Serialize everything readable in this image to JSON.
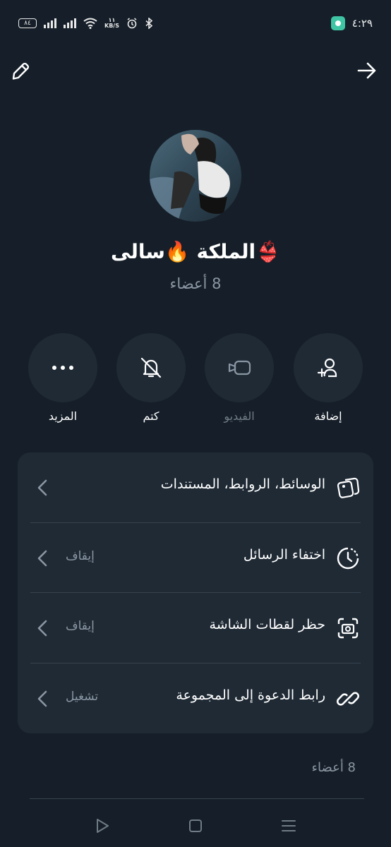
{
  "status_bar": {
    "battery": "٨٤",
    "net_speed_value": "١١",
    "net_speed_unit": "KB/S",
    "time": "٤:٢٩"
  },
  "group": {
    "title": "👙الملكة 🔥سالى",
    "members": "8 أعضاء"
  },
  "actions": [
    {
      "label": "إضافة",
      "icon": "add-person-icon"
    },
    {
      "label": "الفيديو",
      "icon": "video-camera-icon"
    },
    {
      "label": "كتم",
      "icon": "bell-muted-icon"
    },
    {
      "label": "المزيد",
      "icon": "more-dots-icon"
    }
  ],
  "settings": [
    {
      "title": "الوسائط، الروابط، المستندات",
      "status": "",
      "icon": "media-gallery-icon"
    },
    {
      "title": "اختفاء الرسائل",
      "status": "إيقاف",
      "icon": "disappearing-timer-icon"
    },
    {
      "title": "حظر لقطات الشاشة",
      "status": "إيقاف",
      "icon": "screenshot-block-icon"
    },
    {
      "title": "رابط الدعوة إلى المجموعة",
      "status": "تشغيل",
      "icon": "link-icon"
    }
  ],
  "members_heading": "8 أعضاء",
  "colors": {
    "background": "#161f29",
    "card": "#1f2a35",
    "muted_text": "#8a96a3",
    "divider": "#36424f"
  }
}
